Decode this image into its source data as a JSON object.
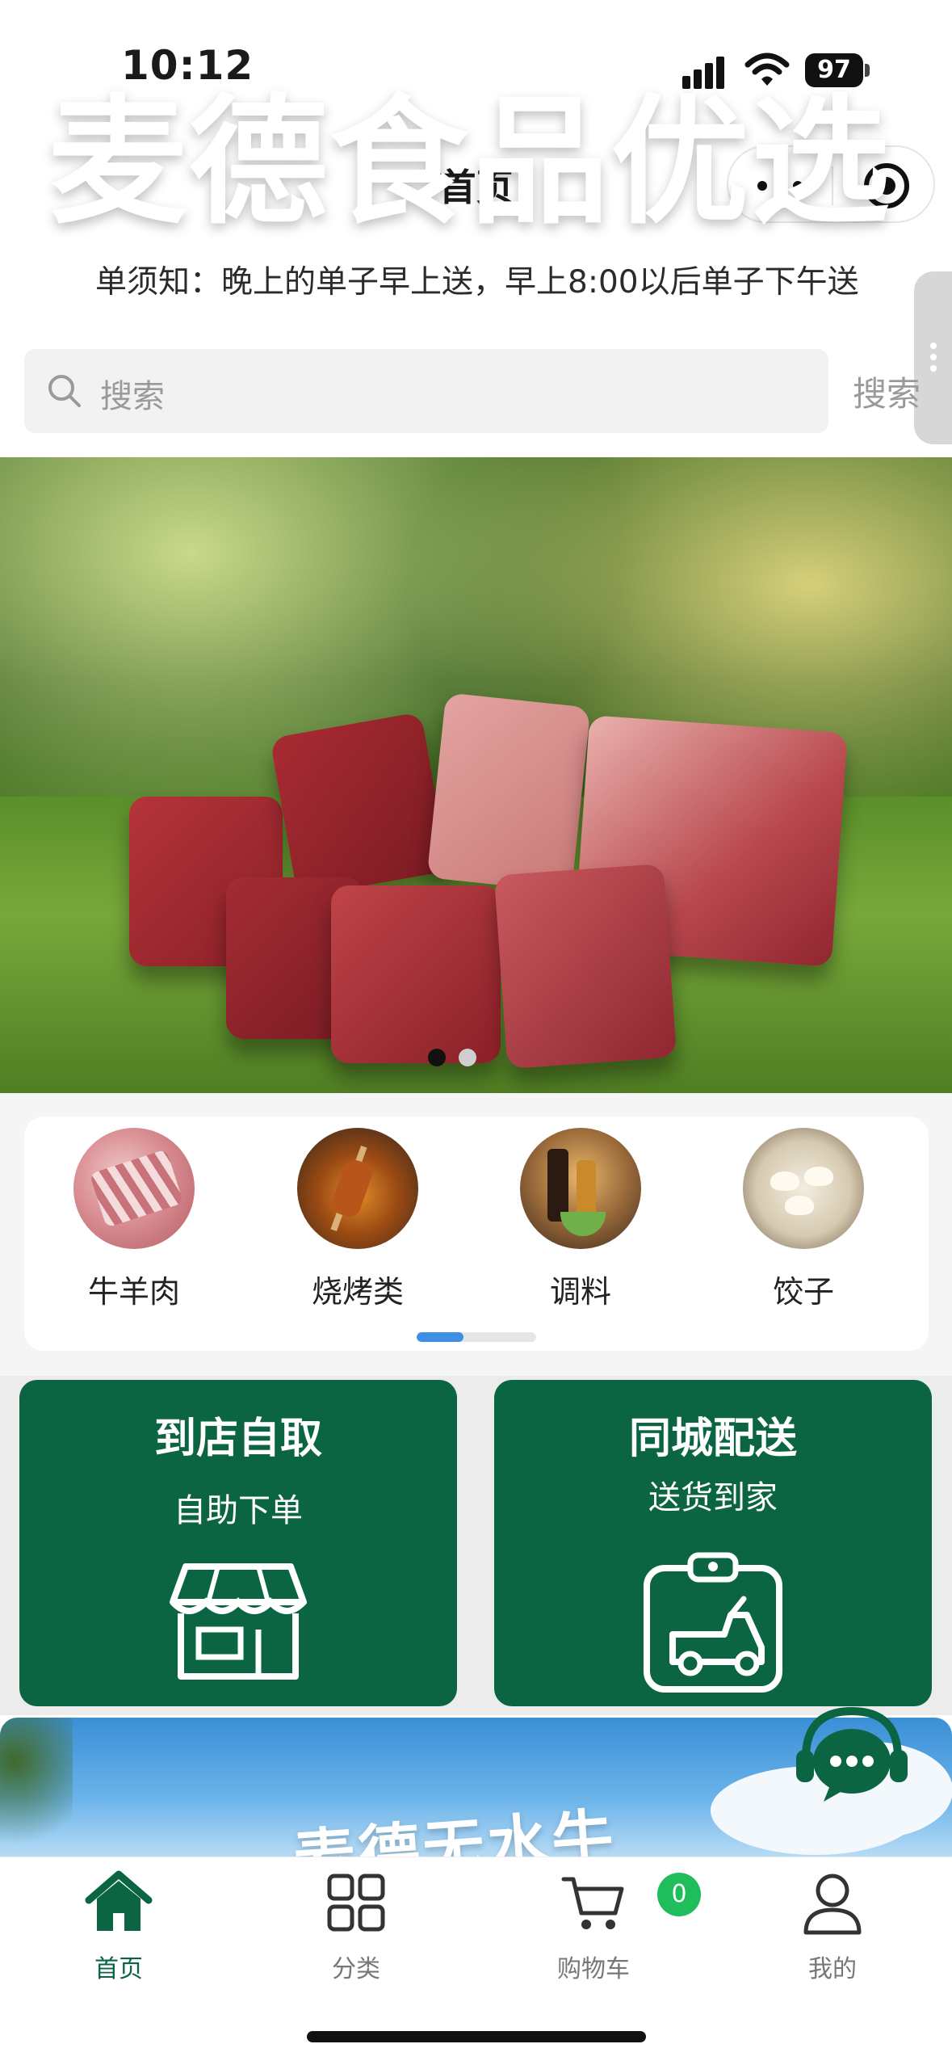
{
  "status_bar": {
    "time": "10:12",
    "battery": "97"
  },
  "nav": {
    "title": "首页"
  },
  "notice": {
    "text": "单须知：晚上的单子早上送，早上8:00以后单子下午送"
  },
  "search": {
    "placeholder": "搜索",
    "button": "搜索"
  },
  "banner": {
    "title": "麦德食品优选",
    "registered_mark": "®",
    "slide_count": 2,
    "active_slide": 1
  },
  "categories": [
    {
      "label": "牛羊肉",
      "icon": "meat-ribs"
    },
    {
      "label": "烧烤类",
      "icon": "bbq-skewers"
    },
    {
      "label": "调料",
      "icon": "seasoning-bottles"
    },
    {
      "label": "饺子",
      "icon": "dumplings-plate"
    }
  ],
  "services": {
    "pickup": {
      "title": "到店自取",
      "subtitle": "自助下单",
      "icon": "store-icon"
    },
    "delivery": {
      "title": "同城配送",
      "subtitle": "送货到家",
      "icon": "delivery-clipboard-icon"
    }
  },
  "promo": {
    "text": "麦德无水牛"
  },
  "tabbar": {
    "items": [
      {
        "label": "首页",
        "icon": "home-icon",
        "active": true
      },
      {
        "label": "分类",
        "icon": "grid-icon",
        "active": false
      },
      {
        "label": "购物车",
        "icon": "cart-icon",
        "active": false
      },
      {
        "label": "我的",
        "icon": "user-icon",
        "active": false
      }
    ],
    "cart_count": "0"
  },
  "colors": {
    "brand_green": "#0b6542",
    "badge_green": "#1fbd5c",
    "scroll_blue": "#3f8fe6"
  }
}
